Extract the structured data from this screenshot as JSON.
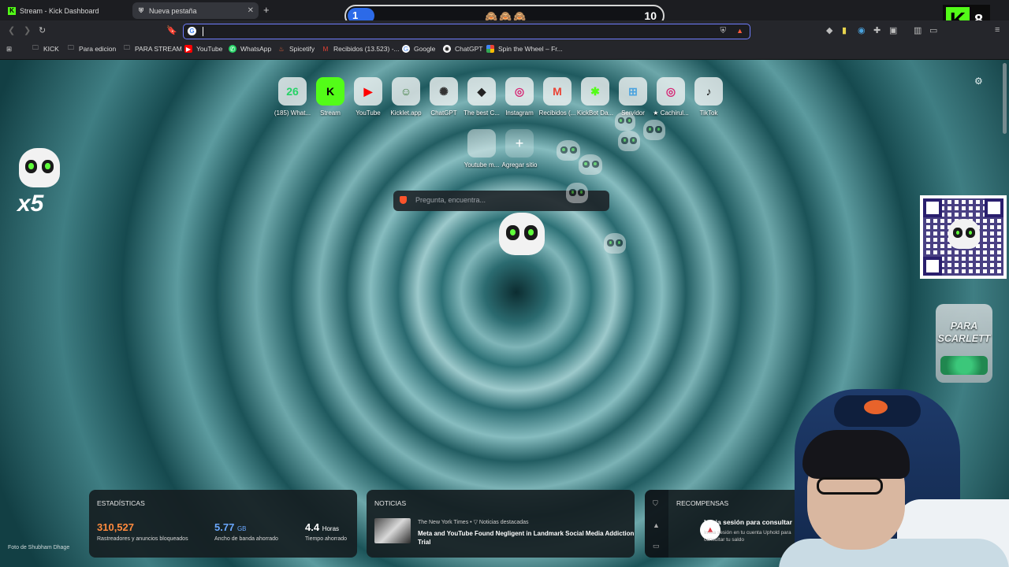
{
  "tabs": [
    {
      "title": "Stream - Kick Dashboard",
      "icon": "kick-icon"
    },
    {
      "title": "Nueva pestaña",
      "icon": "brave-icon"
    }
  ],
  "overlay": {
    "left_count": "1",
    "right_count": "10",
    "emojis": "🙈🙈🙈",
    "kick_viewers": "8",
    "kick_letter": "K"
  },
  "urlbar": {
    "value": "",
    "engine_letter": "G"
  },
  "bookmarks": [
    {
      "label": "KICK",
      "icon": "folder-icon"
    },
    {
      "label": "Para edicion",
      "icon": "folder-icon"
    },
    {
      "label": "PARA STREAM",
      "icon": "folder-icon"
    },
    {
      "label": "YouTube",
      "icon": "youtube-icon"
    },
    {
      "label": "WhatsApp",
      "icon": "whatsapp-icon"
    },
    {
      "label": "Spicetify",
      "icon": "spicetify-icon"
    },
    {
      "label": "Recibidos (13.523) -...",
      "icon": "gmail-icon"
    },
    {
      "label": "Google",
      "icon": "google-icon"
    },
    {
      "label": "ChatGPT",
      "icon": "chatgpt-icon"
    },
    {
      "label": "Spin the Wheel – Fr...",
      "icon": "wheel-icon"
    }
  ],
  "shortcuts": [
    {
      "label": "(185) What...",
      "glyph": "26",
      "color": "#25d366"
    },
    {
      "label": "Stream",
      "glyph": "K",
      "color": "#53fc18"
    },
    {
      "label": "YouTube",
      "glyph": "▶",
      "color": "#ff0000"
    },
    {
      "label": "Kicklet.app",
      "glyph": "☺",
      "color": "#3a7a3a"
    },
    {
      "label": "ChatGPT",
      "glyph": "✺",
      "color": "#333333"
    },
    {
      "label": "The best C...",
      "glyph": "◆",
      "color": "#222222"
    },
    {
      "label": "Instagram",
      "glyph": "◎",
      "color": "#d62976"
    },
    {
      "label": "Recibidos (...",
      "glyph": "M",
      "color": "#ea4335"
    },
    {
      "label": "KickBot Da...",
      "glyph": "✱",
      "color": "#53fc18"
    },
    {
      "label": "Servidor",
      "glyph": "⊞",
      "color": "#4aa3df"
    },
    {
      "label": "★ Cachirul...",
      "glyph": "◎",
      "color": "#d62976"
    },
    {
      "label": "TikTok",
      "glyph": "♪",
      "color": "#111111"
    }
  ],
  "shortcuts_row2": [
    {
      "label": "Youtube m...",
      "glyph": "",
      "color": "#cccccc"
    },
    {
      "label": "Agregar sitio",
      "glyph": "+",
      "color": "#ffffff"
    }
  ],
  "search": {
    "placeholder": "Pregunta, encuentra..."
  },
  "overlay_text": {
    "multiplier": "x5",
    "jar_title": "PARA SCARLETT"
  },
  "stats": {
    "title": "ESTADÍSTICAS",
    "trackers_value": "310,527",
    "trackers_label": "Rastreadores y anuncios bloqueados",
    "bandwidth_value": "5.77",
    "bandwidth_unit": "GB",
    "bandwidth_label": "Ancho de banda ahorrado",
    "time_value": "4.4",
    "time_unit": "Horas",
    "time_label": "Tiempo ahorrado"
  },
  "news": {
    "title": "NOTICIAS",
    "source": "The New York Times",
    "tag": "Noticias destacadas",
    "headline": "Meta and YouTube Found Negligent in Landmark Social Media Addiction Trial"
  },
  "rewards": {
    "title": "RECOMPENSAS",
    "heading": "Inicia sesión para consultar",
    "body": "Inicia sesión en tu cuenta Uphold para consultar tu saldo",
    "logo_letter": "▲"
  },
  "photo_credit": "Foto de Shubham Dhage",
  "colors": {
    "accent": "#6f7dff",
    "kick_green": "#53fc18",
    "stat_orange": "#ff8a3d",
    "stat_blue": "#6aa8ff"
  }
}
